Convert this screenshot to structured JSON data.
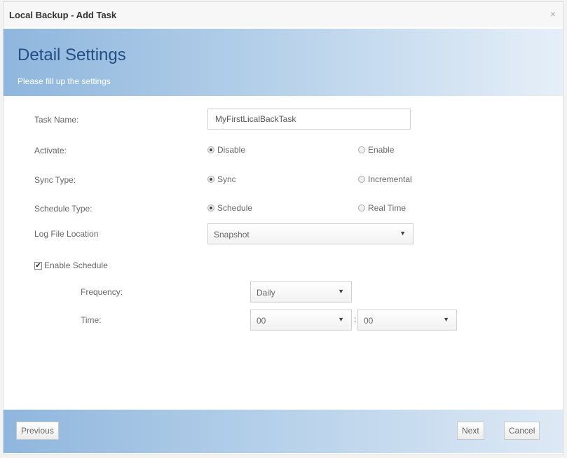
{
  "window": {
    "title": "Local Backup - Add Task",
    "close_symbol": "×"
  },
  "header": {
    "title": "Detail Settings",
    "subtitle": "Please fill up the settings"
  },
  "form": {
    "task_name": {
      "label": "Task Name:",
      "value": "MyFirstLicalBackTask"
    },
    "activate": {
      "label": "Activate:",
      "options": [
        "Disable",
        "Enable"
      ],
      "selected": "Disable"
    },
    "sync_type": {
      "label": "Sync Type:",
      "options": [
        "Sync",
        "Incremental"
      ],
      "selected": "Sync"
    },
    "schedule_type": {
      "label": "Schedule Type:",
      "options": [
        "Schedule",
        "Real Time"
      ],
      "selected": "Schedule"
    },
    "log_file_location": {
      "label": "Log File Location",
      "value": "Snapshot"
    },
    "enable_schedule": {
      "label": "Enable Schedule",
      "checked": true
    },
    "frequency": {
      "label": "Frequency:",
      "value": "Daily"
    },
    "time": {
      "label": "Time:",
      "hour": "00",
      "minute": "00",
      "separator": ":"
    }
  },
  "footer": {
    "previous": "Previous",
    "next": "Next",
    "cancel": "Cancel"
  },
  "colors": {
    "banner_blue": "#8fb6dd",
    "title_blue": "#244f86"
  }
}
